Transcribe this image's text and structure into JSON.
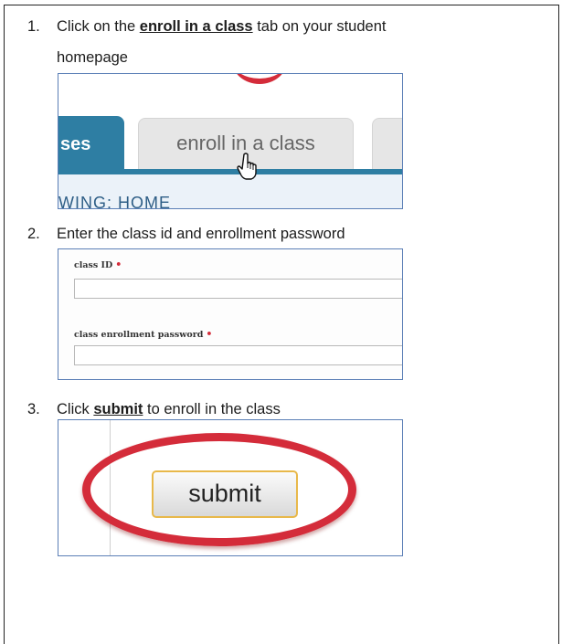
{
  "steps": [
    {
      "number": "1.",
      "before": "Click on the ",
      "link": "enroll in a class",
      "after": " tab on your student",
      "line2": "homepage"
    },
    {
      "number": "2.",
      "text": "Enter the class id and enrollment password"
    },
    {
      "number": "3.",
      "before": "Click ",
      "link": "submit",
      "after": " to enroll in the class"
    }
  ],
  "shot1": {
    "active_tab": "ses",
    "enroll_tab": "enroll in a class",
    "breadcrumb": "WING: HOME",
    "accent_color": "#2e7ea3"
  },
  "shot2": {
    "class_id_label": "class ID",
    "password_label": "class enrollment password",
    "required_mark": "•"
  },
  "shot3": {
    "submit_label": "submit",
    "highlight_color": "#d42c3a"
  }
}
